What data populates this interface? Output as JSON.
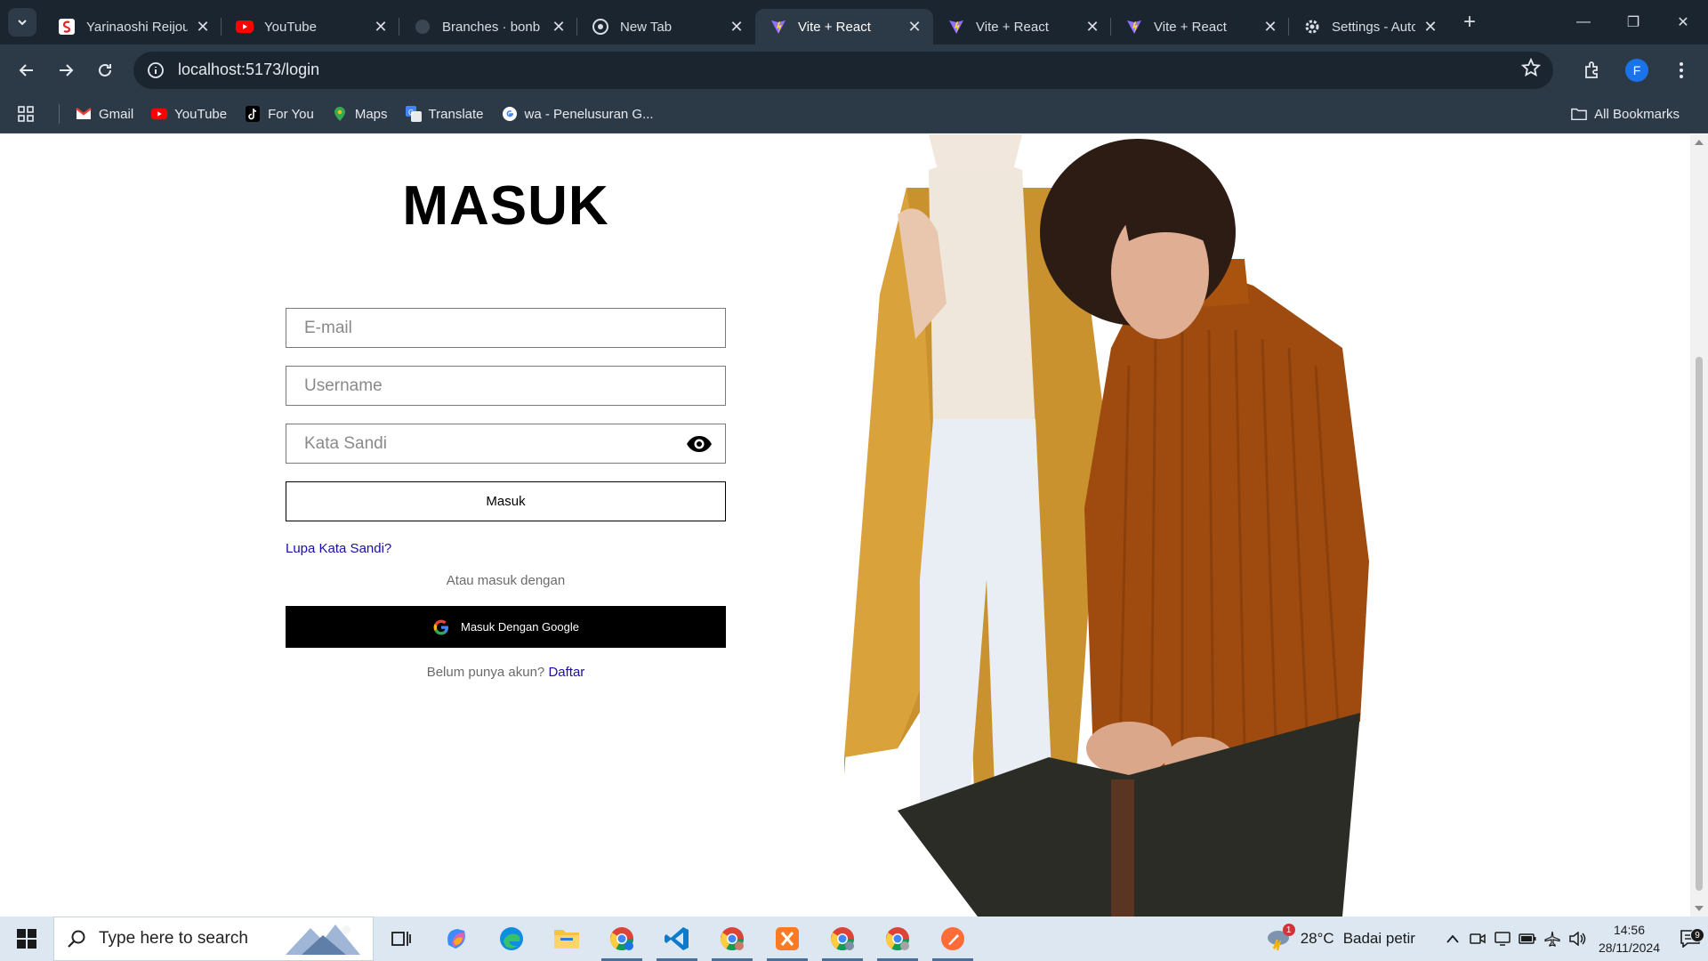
{
  "browser": {
    "tabs": [
      {
        "title": "Yarinaoshi Reijou",
        "icon": "scribd-icon",
        "active": false
      },
      {
        "title": "YouTube",
        "icon": "youtube-icon",
        "active": false
      },
      {
        "title": "Branches · bonb",
        "icon": "github-icon",
        "active": false
      },
      {
        "title": "New Tab",
        "icon": "chrome-icon",
        "active": false
      },
      {
        "title": "Vite + React",
        "icon": "vite-icon",
        "active": true
      },
      {
        "title": "Vite + React",
        "icon": "vite-icon",
        "active": false
      },
      {
        "title": "Vite + React",
        "icon": "vite-icon",
        "active": false
      },
      {
        "title": "Settings - Autofi",
        "icon": "settings-gear-icon",
        "active": false
      }
    ],
    "url": "localhost:5173/login",
    "profile_initial": "F",
    "bookmarks": [
      {
        "label": "Gmail",
        "icon": "gmail-icon"
      },
      {
        "label": "YouTube",
        "icon": "youtube-icon"
      },
      {
        "label": "For You",
        "icon": "tiktok-icon"
      },
      {
        "label": "Maps",
        "icon": "maps-icon"
      },
      {
        "label": "Translate",
        "icon": "translate-icon"
      },
      {
        "label": "wa - Penelusuran G...",
        "icon": "google-icon"
      }
    ],
    "all_bookmarks": "All Bookmarks"
  },
  "login": {
    "title": "MASUK",
    "email_placeholder": "E-mail",
    "username_placeholder": "Username",
    "password_placeholder": "Kata Sandi",
    "submit_label": "Masuk",
    "forgot_label": "Lupa Kata Sandi?",
    "alt_text": "Atau masuk dengan",
    "google_label": "Masuk Dengan Google",
    "register_prompt": "Belum punya akun?",
    "register_link": "Daftar"
  },
  "taskbar": {
    "search_placeholder": "Type here to search",
    "weather_temp": "28°C",
    "weather_desc": "Badai petir",
    "weather_badge": "1",
    "time": "14:56",
    "date": "28/11/2024",
    "notification_count": "9"
  },
  "colors": {
    "chrome_bg": "#1f2a37",
    "link": "#1a0dab",
    "google_button": "#000000",
    "taskbar_bg": "#dde7f2"
  }
}
